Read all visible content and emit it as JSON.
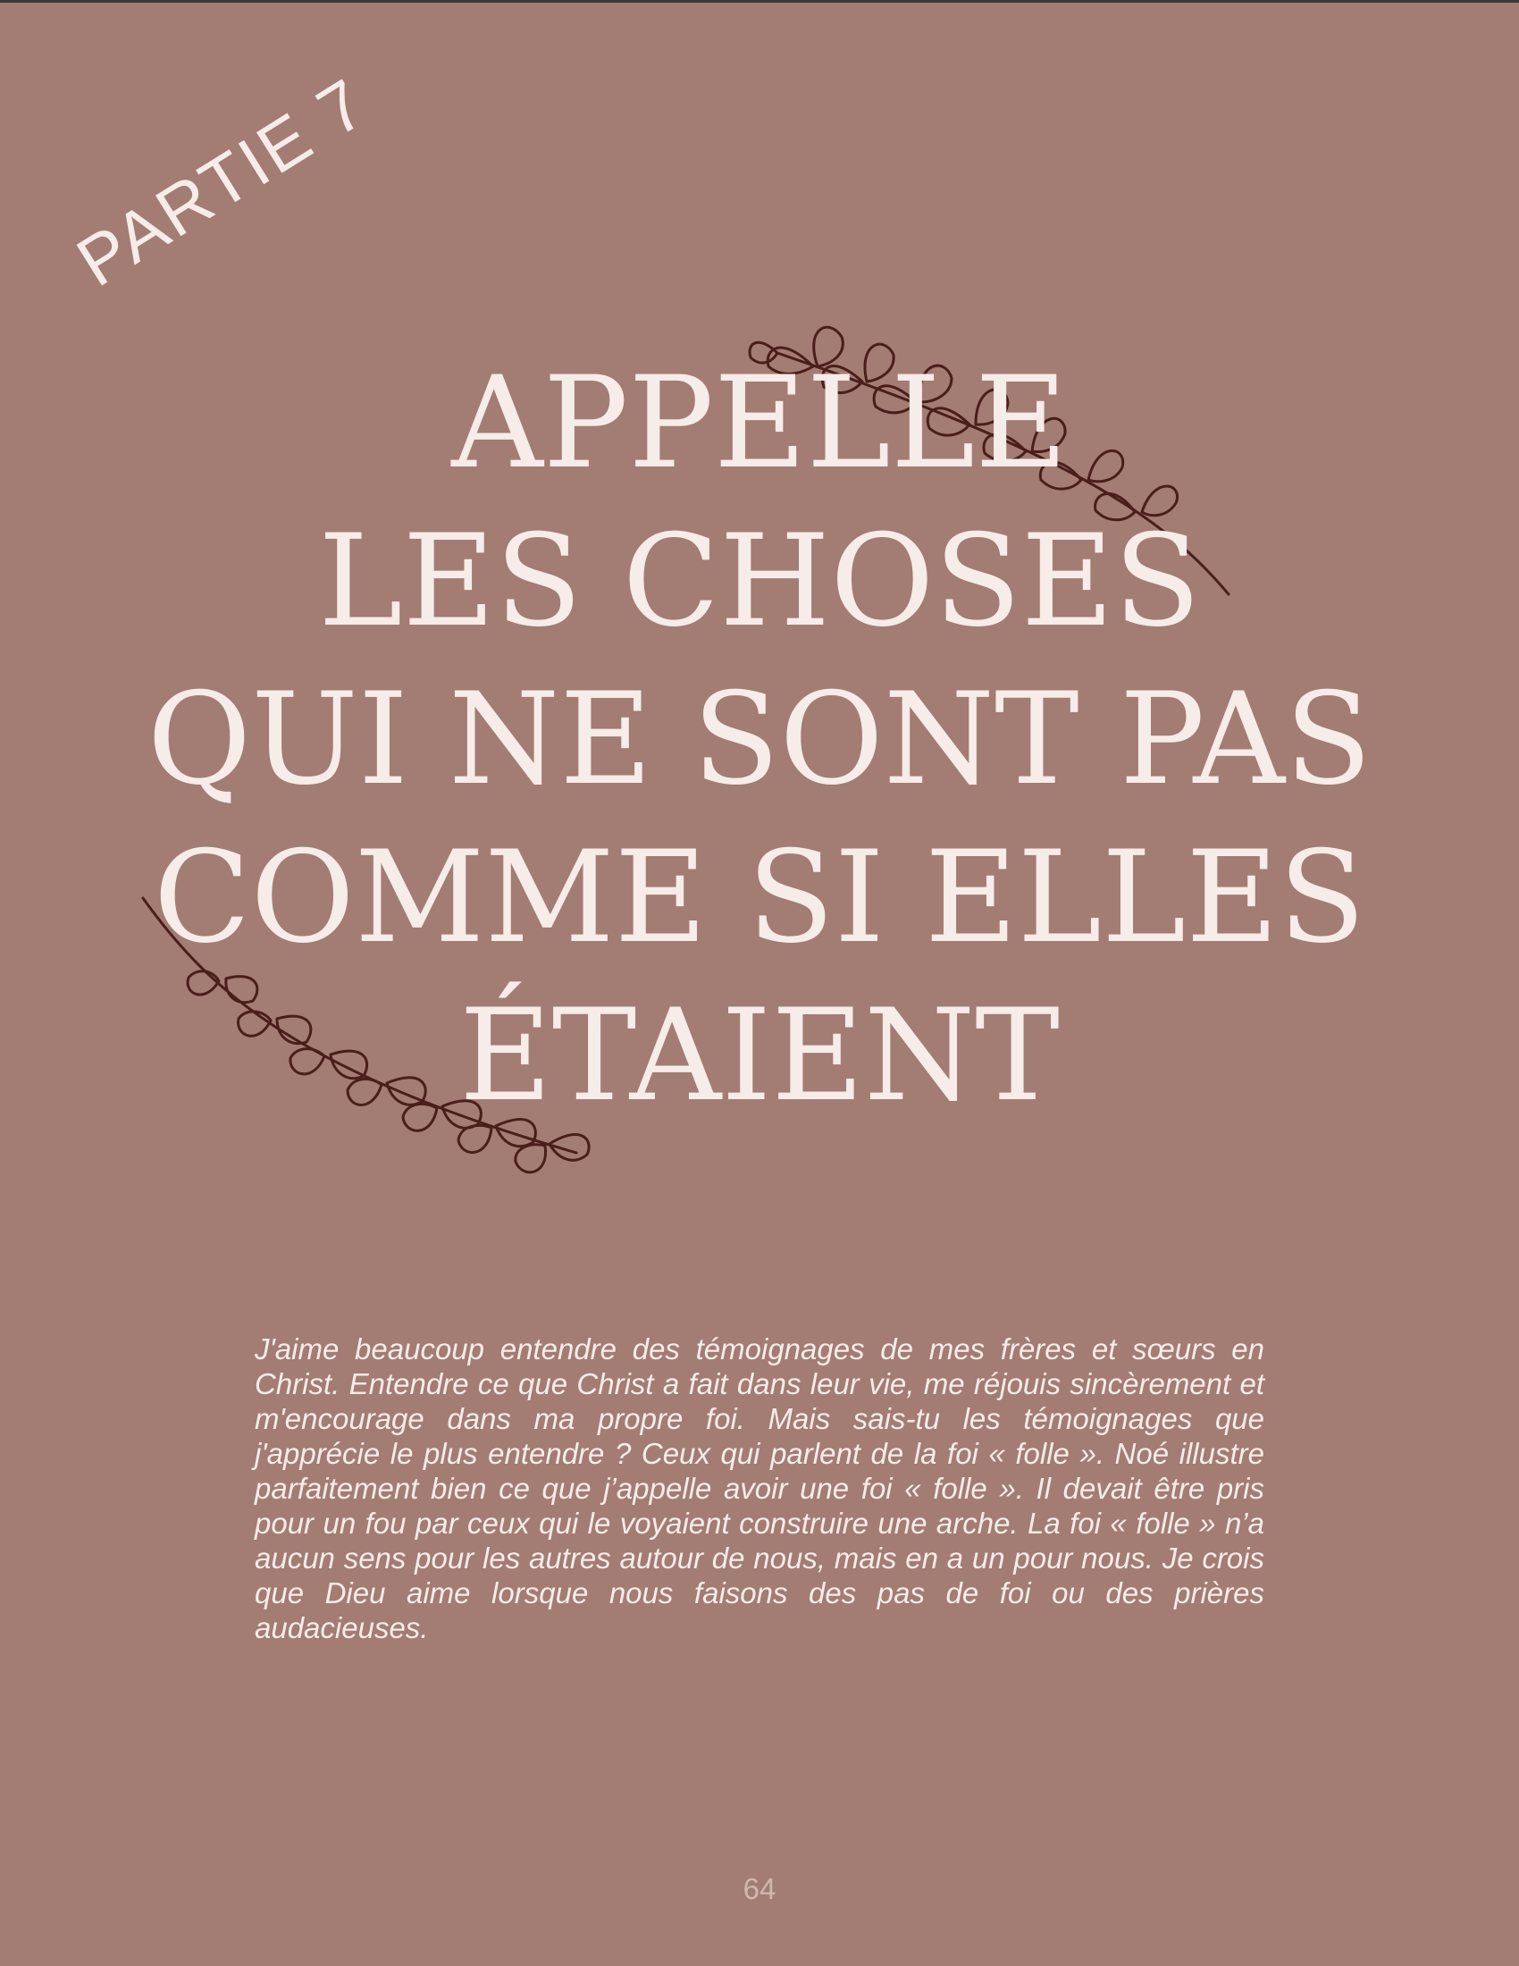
{
  "part_label": "PARTIE 7",
  "title_lines": [
    "APPELLE",
    "LES CHOSES",
    "QUI NE SONT PAS",
    "COMME SI ELLES",
    "ÉTAIENT"
  ],
  "body_paragraph": "J'aime beaucoup entendre des témoignages de mes frères et sœurs en Christ. Entendre ce que Christ a fait dans leur vie, me réjouis sincèrement et m'encourage dans ma propre foi. Mais sais-tu les témoignages que j'apprécie le plus entendre ? Ceux qui parlent de la foi « folle ». Noé illustre parfaitement bien ce que j’appelle avoir une foi « folle ». Il devait être pris pour un fou par ceux qui le voyaient construire une arche. La foi « folle » n’a aucun sens pour les autres autour de nous, mais en a un pour nous. Je crois que Dieu aime lorsque nous faisons des pas de foi ou des prières audacieuses.",
  "page_number": "64",
  "colors": {
    "background": "#a37c74",
    "text": "#f6ece8",
    "leaf_stroke": "#4a1e1a",
    "page_number": "#d2b7af"
  },
  "icons": [
    "leaf-branch-icon"
  ]
}
